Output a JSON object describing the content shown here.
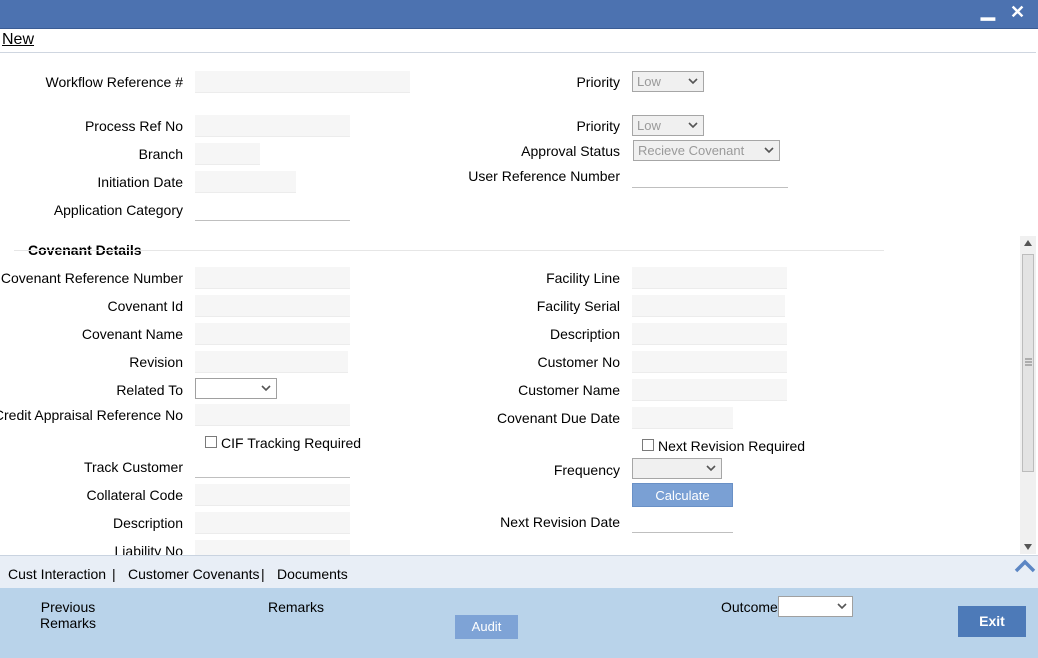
{
  "window": {
    "minimize_glyph": "▁",
    "close_glyph": "✕"
  },
  "menu": {
    "new_label": "New"
  },
  "header": {
    "workflow_ref_label": "Workflow Reference #",
    "priority1_label": "Priority",
    "priority1_value": "Low",
    "process_ref_label": "Process Ref No",
    "priority2_label": "Priority",
    "priority2_value": "Low",
    "branch_label": "Branch",
    "approval_status_label": "Approval Status",
    "approval_status_value": "Recieve Covenant",
    "initiation_date_label": "Initiation Date",
    "user_ref_label": "User Reference Number",
    "application_category_label": "Application Category"
  },
  "covenant": {
    "section_title": "Covenant Details",
    "ref_number_label": "Covenant Reference Number",
    "id_label": "Covenant Id",
    "name_label": "Covenant Name",
    "revision_label": "Revision",
    "related_to_label": "Related To",
    "credit_appraisal_label": "Credit Appraisal Reference No",
    "cif_tracking_label": "CIF Tracking Required",
    "track_customer_label": "Track Customer",
    "collateral_code_label": "Collateral Code",
    "description_left_label": "Description",
    "liability_no_label": "Liability No",
    "facility_line_label": "Facility Line",
    "facility_serial_label": "Facility Serial",
    "description_right_label": "Description",
    "customer_no_label": "Customer No",
    "customer_name_label": "Customer Name",
    "due_date_label": "Covenant Due Date",
    "next_revision_required_label": "Next Revision Required",
    "frequency_label": "Frequency",
    "calculate_label": "Calculate",
    "next_revision_date_label": "Next Revision Date"
  },
  "tabs": {
    "cust_interaction": "Cust Interaction",
    "customer_covenants": "Customer Covenants",
    "documents": "Documents",
    "separator": "|"
  },
  "footer": {
    "previous_remarks_line1": "Previous",
    "previous_remarks_line2": "Remarks",
    "remarks_label": "Remarks",
    "audit_label": "Audit",
    "outcome_label": "Outcome",
    "exit_label": "Exit"
  }
}
